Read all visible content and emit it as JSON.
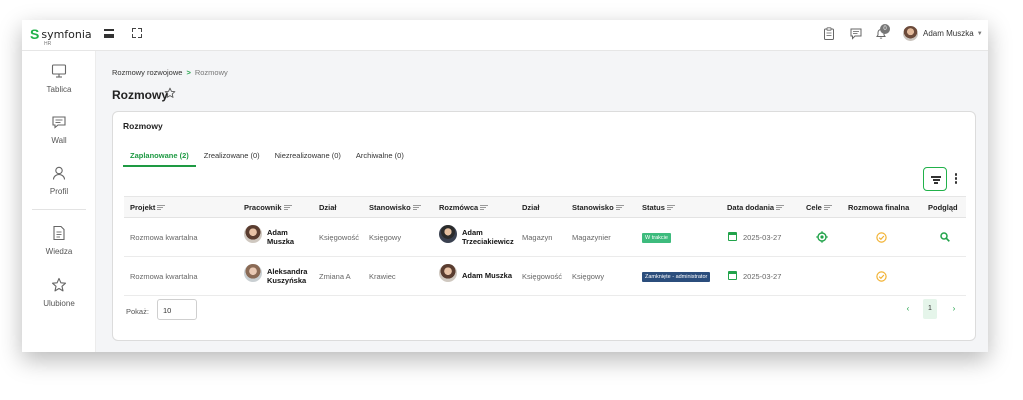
{
  "app": {
    "logo_text": "symfonia",
    "logo_sub": "HR"
  },
  "topbar": {
    "notification_count": "0",
    "user_name": "Adam Muszka"
  },
  "sidebar": {
    "items": [
      {
        "label": "Tablica",
        "icon": "monitor-icon"
      },
      {
        "label": "Wall",
        "icon": "chat-icon"
      },
      {
        "label": "Profil",
        "icon": "user-icon"
      },
      {
        "label": "Wiedza",
        "icon": "document-icon"
      },
      {
        "label": "Ulubione",
        "icon": "star-icon"
      }
    ]
  },
  "breadcrumb": {
    "parent": "Rozmowy rozwojowe",
    "separator": ">",
    "current": "Rozmowy"
  },
  "page": {
    "title": "Rozmowy"
  },
  "card": {
    "title": "Rozmowy",
    "tabs": [
      {
        "label": "Zaplanowane (2)",
        "active": true
      },
      {
        "label": "Zrealizowane (0)",
        "active": false
      },
      {
        "label": "Niezrealizowane (0)",
        "active": false
      },
      {
        "label": "Archiwalne (0)",
        "active": false
      }
    ]
  },
  "table": {
    "headers": [
      "Projekt",
      "Pracownik",
      "Dział",
      "Stanowisko",
      "Rozmówca",
      "Dział",
      "Stanowisko",
      "Status",
      "Data dodania",
      "Cele",
      "Rozmowa finalna",
      "Podgląd"
    ],
    "rows": [
      {
        "projekt": "Rozmowa kwartalna",
        "pracownik_1": "Adam",
        "pracownik_2": "Muszka",
        "dzial": "Księgowość",
        "stanowisko": "Księgowy",
        "rozmowca_1": "Adam",
        "rozmowca_2": "Trzeciakiewicz",
        "dzial_r": "Magazyn",
        "stanowisko_r": "Magazynier",
        "status": "W trakcie",
        "status_color": "#3dbb7d",
        "data": "2025-03-27",
        "has_goals": true,
        "has_preview": true
      },
      {
        "projekt": "Rozmowa kwartalna",
        "pracownik_1": "Aleksandra",
        "pracownik_2": "Kuszyńska",
        "dzial": "Zmiana A",
        "stanowisko": "Krawiec",
        "rozmowca_1": "Adam Muszka",
        "rozmowca_2": "",
        "dzial_r": "Księgowość",
        "stanowisko_r": "Księgowy",
        "status": "Zamknięte - administrator",
        "status_color": "#2b4d7c",
        "data": "2025-03-27",
        "has_goals": false,
        "has_preview": false
      }
    ]
  },
  "pagination": {
    "label": "Pokaż:",
    "page_size": "10",
    "prev": "‹",
    "current_page": "1",
    "next": "›"
  },
  "colors": {
    "accent": "#21a34a",
    "warning": "#f2b233"
  }
}
